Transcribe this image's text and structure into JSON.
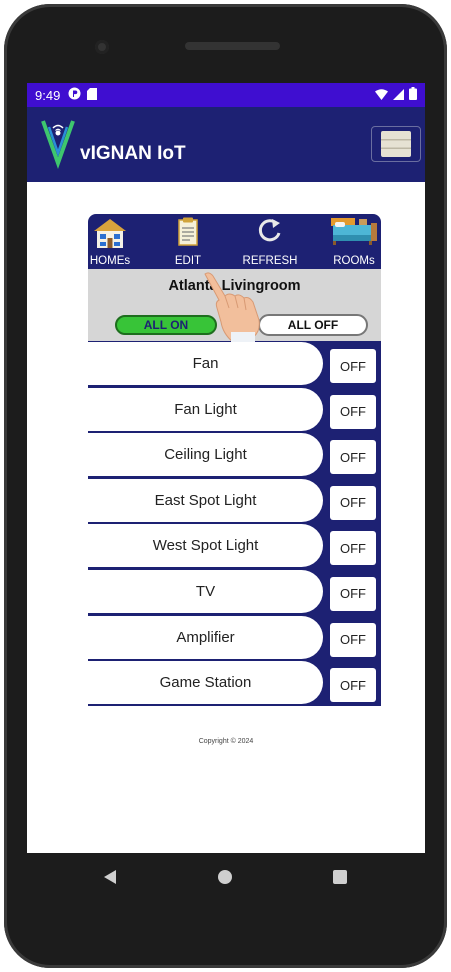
{
  "status_bar": {
    "time": "9:49"
  },
  "app": {
    "title": "vIGNAN IoT",
    "menu_icon": "hamburger-icon"
  },
  "toolbar": {
    "homes_label": "HOMEs",
    "edit_label": "EDIT",
    "refresh_label": "REFRESH",
    "rooms_label": "ROOMs"
  },
  "room": {
    "name": "Atlanta Livingroom",
    "all_on_label": "ALL ON",
    "all_off_label": "ALL OFF"
  },
  "devices": [
    {
      "name": "Fan",
      "state": "OFF"
    },
    {
      "name": "Fan Light",
      "state": "OFF"
    },
    {
      "name": "Ceiling Light",
      "state": "OFF"
    },
    {
      "name": "East Spot Light",
      "state": "OFF"
    },
    {
      "name": "West Spot Light",
      "state": "OFF"
    },
    {
      "name": "TV",
      "state": "OFF"
    },
    {
      "name": "Amplifier",
      "state": "OFF"
    },
    {
      "name": "Game Station",
      "state": "OFF"
    }
  ],
  "footer": {
    "copyright": "Copyright © 2024"
  },
  "colors": {
    "status_bar": "#3f0ed0",
    "app_bar": "#1d2173",
    "all_on_green": "#38c438"
  }
}
